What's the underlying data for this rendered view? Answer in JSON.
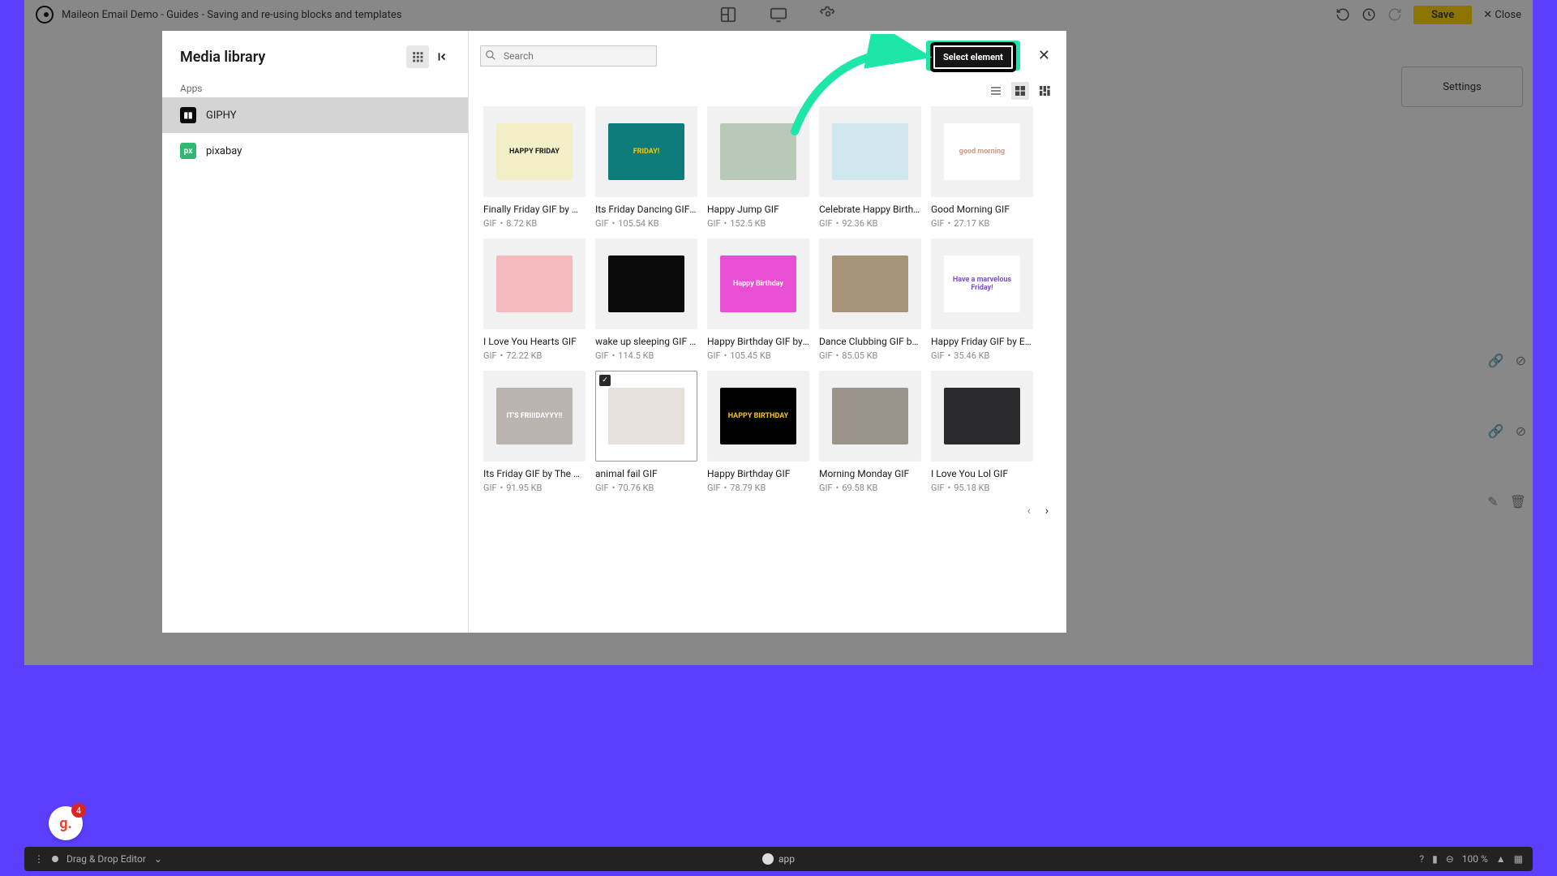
{
  "header": {
    "title": "Maileon Email Demo - Guides - Saving and re-using blocks and templates",
    "save_label": "Save",
    "close_label": "Close"
  },
  "right_panel": {
    "settings": "Settings"
  },
  "modal": {
    "title": "Media library",
    "apps_label": "Apps",
    "apps": [
      {
        "name": "GIPHY",
        "active": true
      },
      {
        "name": "pixabay",
        "active": false
      }
    ],
    "search_placeholder": "Search",
    "select_element_label": "Select element"
  },
  "gifs": [
    {
      "title": "Finally Friday GIF by Win…",
      "type": "GIF",
      "size": "8.72 KB",
      "bg": "#F3EFC9",
      "fg": "#1b1b1b",
      "label": "HAPPY FRIDAY"
    },
    {
      "title": "Its Friday Dancing GIF b…",
      "type": "GIF",
      "size": "105.54 KB",
      "bg": "#0E7C7B",
      "fg": "#F4C713",
      "label": "FRIDAY!"
    },
    {
      "title": "Happy Jump GIF",
      "type": "GIF",
      "size": "152.5 KB",
      "bg": "#B9C9B8",
      "fg": "#3b3b3b",
      "label": ""
    },
    {
      "title": "Celebrate Happy Birthda…",
      "type": "GIF",
      "size": "92.36 KB",
      "bg": "#CFE8EF",
      "fg": "#333",
      "label": ""
    },
    {
      "title": "Good Morning GIF",
      "type": "GIF",
      "size": "27.17 KB",
      "bg": "#FFFFFF",
      "fg": "#C98",
      "label": "good morning"
    },
    {
      "title": "I Love You Hearts GIF",
      "type": "GIF",
      "size": "72.22 KB",
      "bg": "#F6B9BD",
      "fg": "#C31",
      "label": ""
    },
    {
      "title": "wake up sleeping GIF by…",
      "type": "GIF",
      "size": "114.5 KB",
      "bg": "#0B0B0B",
      "fg": "#9B2",
      "label": ""
    },
    {
      "title": "Happy Birthday GIF by H…",
      "type": "GIF",
      "size": "105.45 KB",
      "bg": "#E84FD4",
      "fg": "#FFE",
      "label": "Happy Birthday"
    },
    {
      "title": "Dance Clubbing GIF by C…",
      "type": "GIF",
      "size": "85.05 KB",
      "bg": "#A79378",
      "fg": "#222",
      "label": ""
    },
    {
      "title": "Happy Friday GIF by Eln…",
      "type": "GIF",
      "size": "35.46 KB",
      "bg": "#FFFFFF",
      "fg": "#7A4FD4",
      "label": "Have a marvelous Friday!"
    },
    {
      "title": "Its Friday GIF by The Off…",
      "type": "GIF",
      "size": "91.95 KB",
      "bg": "#B9B4AE",
      "fg": "#fff",
      "label": "IT'S FRIIIDAYYY!!"
    },
    {
      "title": "animal fail GIF",
      "type": "GIF",
      "size": "70.76 KB",
      "bg": "#E7E2DB",
      "fg": "#333",
      "label": "",
      "selected": true
    },
    {
      "title": "Happy Birthday GIF",
      "type": "GIF",
      "size": "78.79 KB",
      "bg": "#000000",
      "fg": "#F4C713",
      "label": "HAPPY BIRTHDAY"
    },
    {
      "title": "Morning Monday GIF",
      "type": "GIF",
      "size": "69.58 KB",
      "bg": "#9A948B",
      "fg": "#222",
      "label": ""
    },
    {
      "title": "I Love You Lol GIF",
      "type": "GIF",
      "size": "95.18 KB",
      "bg": "#2B2B2E",
      "fg": "#ccc",
      "label": ""
    }
  ],
  "footer": {
    "editor_label": "Drag & Drop Editor",
    "center_label": "app",
    "zoom": "100 %"
  },
  "badge": {
    "count": "4",
    "letter": "g."
  }
}
